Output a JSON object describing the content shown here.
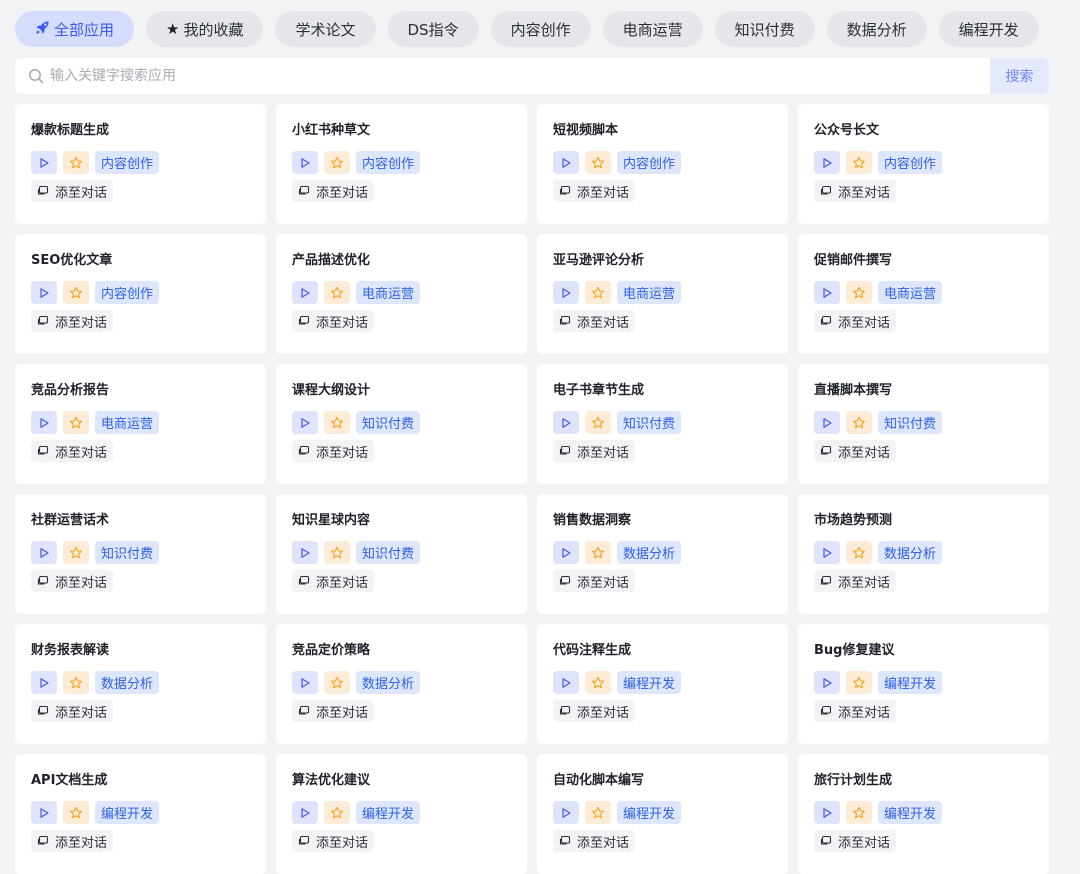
{
  "tabs": [
    {
      "label": "全部应用",
      "icon": "rocket-icon",
      "active": true
    },
    {
      "label": "我的收藏",
      "icon": "star-filled-icon",
      "active": false
    },
    {
      "label": "学术论文",
      "active": false
    },
    {
      "label": "DS指令",
      "active": false
    },
    {
      "label": "内容创作",
      "active": false
    },
    {
      "label": "电商运营",
      "active": false
    },
    {
      "label": "知识付费",
      "active": false
    },
    {
      "label": "数据分析",
      "active": false
    },
    {
      "label": "编程开发",
      "active": false
    }
  ],
  "search": {
    "placeholder": "输入关键字搜索应用",
    "value": "",
    "button_label": "搜索"
  },
  "card_actions": {
    "add_to_chat_label": "添至对话",
    "play_icon": "play-icon",
    "favorite_icon": "star-outline-icon",
    "chat_icon": "chat-icon"
  },
  "colors": {
    "accent": "#3d5af1",
    "tag_text": "#2f61e6",
    "favorite": "#f5a623"
  },
  "apps": [
    {
      "title": "爆款标题生成",
      "category": "内容创作"
    },
    {
      "title": "小红书种草文",
      "category": "内容创作"
    },
    {
      "title": "短视频脚本",
      "category": "内容创作"
    },
    {
      "title": "公众号长文",
      "category": "内容创作"
    },
    {
      "title": "SEO优化文章",
      "category": "内容创作"
    },
    {
      "title": "产品描述优化",
      "category": "电商运营"
    },
    {
      "title": "亚马逊评论分析",
      "category": "电商运营"
    },
    {
      "title": "促销邮件撰写",
      "category": "电商运营"
    },
    {
      "title": "竞品分析报告",
      "category": "电商运营"
    },
    {
      "title": "课程大纲设计",
      "category": "知识付费"
    },
    {
      "title": "电子书章节生成",
      "category": "知识付费"
    },
    {
      "title": "直播脚本撰写",
      "category": "知识付费"
    },
    {
      "title": "社群运营话术",
      "category": "知识付费"
    },
    {
      "title": "知识星球内容",
      "category": "知识付费"
    },
    {
      "title": "销售数据洞察",
      "category": "数据分析"
    },
    {
      "title": "市场趋势预测",
      "category": "数据分析"
    },
    {
      "title": "财务报表解读",
      "category": "数据分析"
    },
    {
      "title": "竞品定价策略",
      "category": "数据分析"
    },
    {
      "title": "代码注释生成",
      "category": "编程开发"
    },
    {
      "title": "Bug修复建议",
      "category": "编程开发"
    },
    {
      "title": "API文档生成",
      "category": "编程开发"
    },
    {
      "title": "算法优化建议",
      "category": "编程开发"
    },
    {
      "title": "自动化脚本编写",
      "category": "编程开发"
    },
    {
      "title": "旅行计划生成",
      "category": "编程开发"
    }
  ]
}
